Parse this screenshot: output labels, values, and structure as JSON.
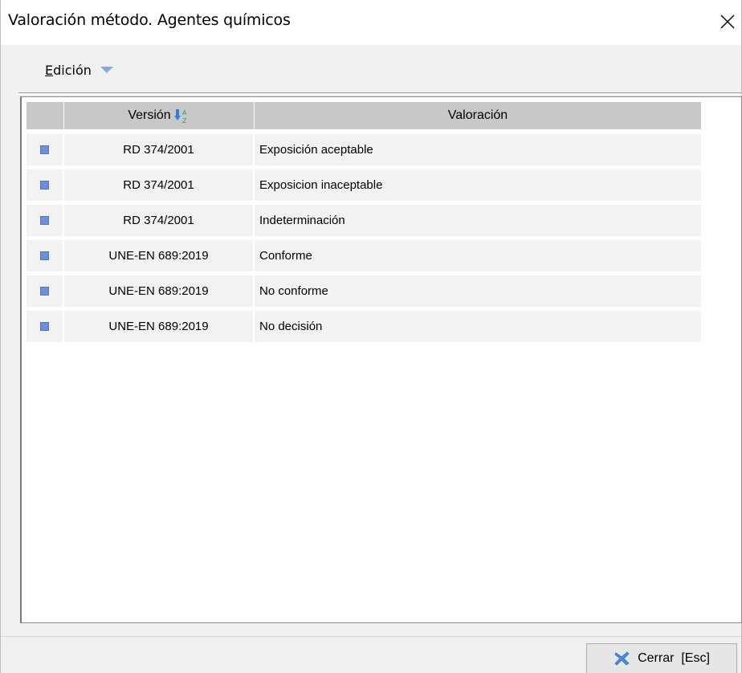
{
  "window": {
    "title": "Valoración método. Agentes químicos"
  },
  "menu": {
    "edicion_first": "E",
    "edicion_rest": "dición"
  },
  "table": {
    "headers": {
      "indicator": "",
      "version": "Versión",
      "valoracion": "Valoración"
    },
    "rows": [
      {
        "version": "RD 374/2001",
        "valoracion": "Exposición aceptable"
      },
      {
        "version": "RD 374/2001",
        "valoracion": "Exposicion inaceptable"
      },
      {
        "version": "RD 374/2001",
        "valoracion": "Indeterminación"
      },
      {
        "version": "UNE-EN 689:2019",
        "valoracion": "Conforme"
      },
      {
        "version": "UNE-EN 689:2019",
        "valoracion": "No conforme"
      },
      {
        "version": "UNE-EN 689:2019",
        "valoracion": "No decisión"
      }
    ]
  },
  "footer": {
    "close_label": "Cerrar  [Esc]"
  },
  "icons": {
    "close": "close-icon",
    "menu_dropdown": "triangle-down-icon",
    "sort": "sort-ascending-icon",
    "row_marker": "row-marker-icon",
    "close_button": "x-mark-icon"
  },
  "colors": {
    "header_bg": "#c8c8c8",
    "row_bg": "#f2f2f2",
    "marker": "#6e8fd0",
    "dropdown_arrow": "#8aa6e0"
  }
}
